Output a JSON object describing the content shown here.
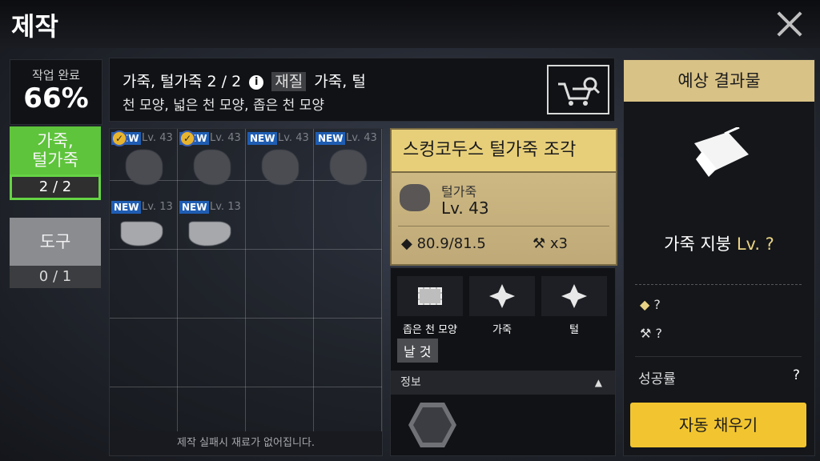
{
  "header": {
    "title": "제작"
  },
  "progress": {
    "label": "작업 완료",
    "percent": "66%"
  },
  "categories": [
    {
      "label": "가죽,\n털가죽",
      "count": "2 / 2",
      "active": true
    },
    {
      "label": "도구",
      "count": "0 / 1",
      "active": false
    }
  ],
  "info": {
    "title": "가죽, 털가죽 2 / 2",
    "material_tag": "재질",
    "materials_inline": "가죽, 털",
    "shapes": "천 모양, 넓은 천 모양, 좁은 천 모양"
  },
  "grid": {
    "items": [
      {
        "badge": "NEW",
        "checked": true,
        "level": "Lv. 43",
        "kind": "blob"
      },
      {
        "badge": "NEW",
        "checked": true,
        "level": "Lv. 43",
        "kind": "blob"
      },
      {
        "badge": "NEW",
        "checked": false,
        "level": "Lv. 43",
        "kind": "blob"
      },
      {
        "badge": "NEW",
        "checked": false,
        "level": "Lv. 43",
        "kind": "blob"
      },
      {
        "badge": "NEW",
        "checked": false,
        "level": "Lv. 13",
        "kind": "pelt"
      },
      {
        "badge": "NEW",
        "checked": false,
        "level": "Lv. 13",
        "kind": "pelt"
      }
    ],
    "footer": "제작 실패시 재료가 없어집니다."
  },
  "detail": {
    "title": "스컹코두스 털가죽 조각",
    "type": "털가죽",
    "level": "Lv. 43",
    "durability": "80.9/81.5",
    "count": "x3"
  },
  "materials": {
    "slots": [
      {
        "label": "좁은 천 모양",
        "icon": "cloth-icon"
      },
      {
        "label": "가죽",
        "icon": "leather-icon"
      },
      {
        "label": "털",
        "icon": "fur-icon"
      }
    ],
    "blade": "날 것",
    "info_header": "정보"
  },
  "result": {
    "header": "예상 결과물",
    "name": "가죽 지붕",
    "level": "Lv. ?",
    "durability": "?",
    "tool": "?",
    "success_label": "성공률",
    "success_value": "?",
    "autofill": "자동 채우기"
  },
  "colors": {
    "accent_green": "#5ec43b",
    "gold": "#d9c286",
    "button_yellow": "#f2c530",
    "new_blue": "#1f5db3"
  }
}
